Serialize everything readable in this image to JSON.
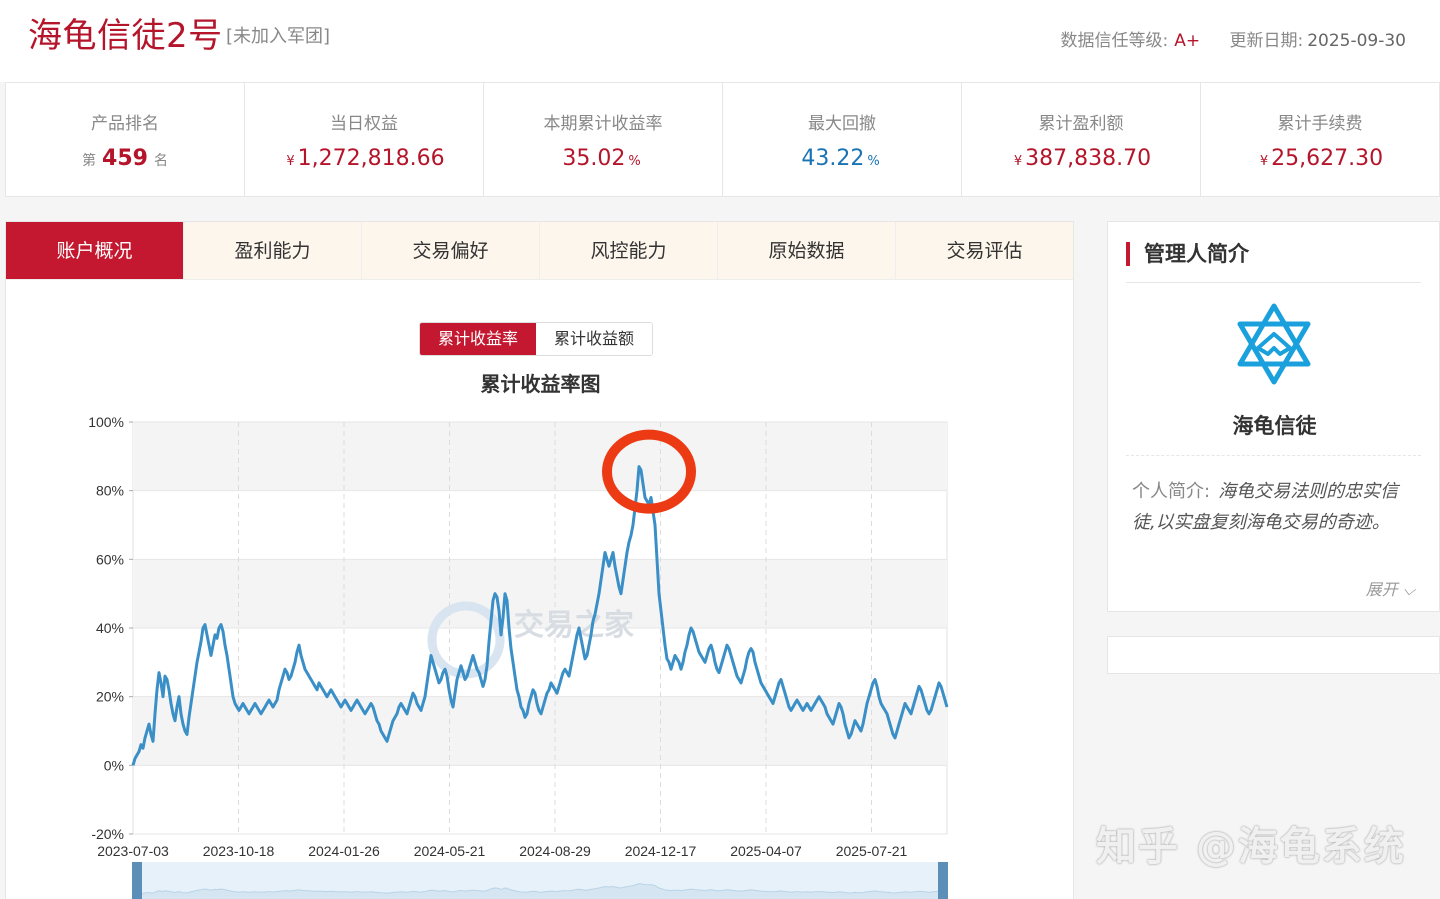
{
  "header": {
    "title": "海龟信徒2号",
    "tag": "[未加入军团]",
    "grade_label": "数据信任等级:",
    "grade": "A+",
    "date_label": "更新日期:",
    "date": "2025-09-30"
  },
  "stats": [
    {
      "label": "产品排名",
      "prefix": "第",
      "value": "459",
      "suffix": "名"
    },
    {
      "label": "当日权益",
      "prefix": "¥",
      "value": "1,272,818.66",
      "suffix": ""
    },
    {
      "label": "本期累计收益率",
      "prefix": "",
      "value": "35.02",
      "suffix": "%"
    },
    {
      "label": "最大回撤",
      "prefix": "",
      "value": "43.22",
      "suffix": "%"
    },
    {
      "label": "累计盈利额",
      "prefix": "¥",
      "value": "387,838.70",
      "suffix": ""
    },
    {
      "label": "累计手续费",
      "prefix": "¥",
      "value": "25,627.30",
      "suffix": ""
    }
  ],
  "tabs": [
    "账户概况",
    "盈利能力",
    "交易偏好",
    "风控能力",
    "原始数据",
    "交易评估"
  ],
  "chart_toggle": [
    "累计收益率",
    "累计收益额"
  ],
  "colors": {
    "brand": "#c3182f",
    "line": "#3a8fc7",
    "highlight": "#ec3b14"
  },
  "chart_data": {
    "type": "line",
    "title": "累计收益率图",
    "xlabel": "",
    "ylabel": "",
    "ylim": [
      -20,
      100
    ],
    "yticks": [
      "100%",
      "80%",
      "60%",
      "40%",
      "20%",
      "0%",
      "-20%"
    ],
    "xticks": [
      "2023-07-03",
      "2023-10-18",
      "2024-01-26",
      "2024-05-21",
      "2024-08-29",
      "2024-12-17",
      "2025-04-07",
      "2025-07-21"
    ],
    "grid": "vertical dashed, alternating horizontal bands",
    "x": [
      0,
      2,
      4,
      6,
      8,
      10,
      12,
      14,
      16,
      18,
      20,
      22,
      24,
      26,
      28,
      30,
      32,
      34,
      36,
      38,
      40,
      42,
      44,
      46,
      48,
      50,
      52,
      54,
      56,
      58,
      60,
      62,
      64,
      66,
      68,
      70,
      72,
      74,
      76,
      78,
      80,
      82,
      84,
      86,
      88,
      90,
      92,
      94,
      96,
      98,
      100,
      102,
      104,
      106,
      108,
      110,
      112,
      114,
      116,
      118,
      120,
      122,
      124,
      126,
      128,
      130,
      132,
      134,
      136,
      138,
      140,
      142,
      144,
      146,
      148,
      150,
      152,
      154,
      156,
      158,
      160,
      162,
      164,
      166,
      168,
      170,
      172,
      174,
      176,
      178,
      180,
      182,
      184,
      186,
      188,
      190,
      192,
      194,
      196,
      198,
      200,
      202,
      204,
      206,
      208,
      210,
      212,
      214,
      216,
      218,
      220,
      222,
      224,
      226,
      228,
      230,
      232,
      234,
      236,
      238,
      240,
      242,
      244,
      246,
      248,
      250,
      252,
      254,
      256,
      258,
      260,
      262,
      264,
      266,
      268,
      270,
      272,
      274,
      276,
      278,
      280,
      282,
      284,
      286,
      288,
      290,
      292,
      294,
      296,
      298,
      300,
      302,
      304,
      306,
      308,
      310,
      312,
      314,
      316,
      318,
      320,
      322,
      324,
      326,
      328,
      330,
      332,
      334,
      336,
      338,
      340,
      342,
      344,
      346,
      348,
      350,
      352,
      354,
      356,
      358,
      360,
      362,
      364,
      366,
      368,
      370,
      372,
      374,
      376,
      378,
      380,
      382,
      384,
      386,
      388,
      390,
      392,
      394,
      396,
      398,
      400,
      402,
      404,
      406,
      408,
      410,
      412,
      414,
      416,
      418,
      420,
      422,
      424,
      426,
      428,
      430,
      432,
      434,
      436,
      438,
      440,
      442,
      444,
      446,
      448,
      450,
      452,
      454,
      456,
      458,
      460,
      462,
      464,
      466,
      468,
      470,
      472,
      474,
      476,
      478,
      480,
      482,
      484,
      486,
      488,
      490,
      492,
      494,
      496,
      498,
      500,
      502,
      504,
      506,
      508,
      510,
      512,
      514,
      516,
      518,
      520,
      522,
      524,
      526,
      528,
      530,
      532,
      534,
      536,
      538,
      540,
      542,
      544,
      546,
      548,
      550,
      552,
      554,
      556,
      558,
      560,
      562,
      564,
      566,
      568,
      570,
      572,
      574,
      576,
      578,
      580,
      582,
      584,
      586,
      588,
      590,
      592,
      594,
      596,
      598,
      600,
      602,
      604,
      606,
      608,
      610,
      612,
      614,
      616,
      618,
      620,
      622,
      624,
      626,
      628,
      630,
      632,
      634,
      636,
      638,
      640,
      642,
      644,
      646,
      648,
      650,
      652,
      654,
      656,
      658,
      660,
      662,
      664,
      666,
      668,
      670,
      672,
      674,
      676,
      678,
      680,
      682,
      684,
      686,
      688,
      690,
      692,
      694,
      696,
      698,
      700,
      702,
      704,
      706,
      708,
      710,
      712,
      714,
      716,
      718,
      720,
      722,
      724,
      726,
      728,
      730,
      732,
      734,
      736,
      738,
      740,
      742,
      744,
      746,
      748,
      750,
      752,
      754,
      756,
      758,
      760,
      762,
      764,
      766,
      768,
      770,
      772,
      774,
      776,
      778,
      780,
      782,
      784,
      786,
      788,
      790,
      792,
      794,
      796,
      798,
      800,
      802,
      804,
      806,
      808,
      810,
      812,
      814
    ],
    "series": [
      {
        "values": [
          0,
          2,
          3,
          4,
          6,
          5,
          8,
          10,
          12,
          9,
          7,
          15,
          22,
          27,
          24,
          20,
          26,
          25,
          22,
          18,
          15,
          13,
          17,
          20,
          15,
          12,
          10,
          9,
          14,
          18,
          22,
          26,
          30,
          33,
          36,
          40,
          41,
          38,
          35,
          32,
          35,
          38,
          37,
          40,
          41,
          39,
          35,
          32,
          28,
          24,
          20,
          18,
          17,
          16,
          17,
          18,
          17,
          16,
          15,
          16,
          17,
          18,
          17,
          16,
          15,
          16,
          17,
          18,
          19,
          18,
          17,
          18,
          19,
          22,
          24,
          26,
          28,
          27,
          25,
          26,
          28,
          30,
          33,
          35,
          32,
          30,
          28,
          27,
          26,
          25,
          24,
          23,
          22,
          24,
          23,
          22,
          21,
          20,
          21,
          22,
          21,
          20,
          19,
          18,
          17,
          18,
          19,
          18,
          17,
          16,
          17,
          18,
          19,
          18,
          17,
          16,
          15,
          16,
          17,
          18,
          17,
          15,
          13,
          12,
          10,
          9,
          8,
          7,
          9,
          11,
          13,
          14,
          15,
          17,
          18,
          17,
          16,
          15,
          17,
          19,
          21,
          20,
          18,
          17,
          16,
          18,
          20,
          24,
          28,
          32,
          30,
          28,
          26,
          24,
          25,
          27,
          28,
          26,
          22,
          19,
          17,
          21,
          25,
          27,
          29,
          27,
          25,
          26,
          28,
          30,
          32,
          30,
          28,
          27,
          25,
          23,
          25,
          29,
          36,
          42,
          48,
          50,
          49,
          45,
          38,
          43,
          50,
          48,
          40,
          34,
          30,
          26,
          22,
          20,
          17,
          16,
          14,
          15,
          18,
          20,
          22,
          21,
          18,
          16,
          15,
          17,
          19,
          21,
          22,
          24,
          23,
          22,
          21,
          23,
          25,
          27,
          28,
          27,
          26,
          29,
          32,
          35,
          38,
          40,
          37,
          34,
          31,
          32,
          35,
          38,
          42,
          44,
          47,
          50,
          54,
          58,
          62,
          60,
          58,
          60,
          62,
          58,
          55,
          52,
          50,
          54,
          58,
          62,
          65,
          67,
          70,
          75,
          80,
          87,
          86,
          82,
          78,
          77,
          76,
          78,
          74,
          70,
          60,
          50,
          45,
          40,
          35,
          31,
          30,
          28,
          30,
          32,
          31,
          30,
          28,
          30,
          33,
          35,
          38,
          40,
          39,
          37,
          35,
          33,
          32,
          31,
          30,
          32,
          34,
          35,
          33,
          30,
          28,
          27,
          29,
          31,
          33,
          35,
          34,
          32,
          30,
          28,
          26,
          25,
          24,
          26,
          28,
          31,
          33,
          34,
          33,
          30,
          28,
          26,
          24,
          23,
          22,
          21,
          20,
          19,
          18,
          20,
          22,
          24,
          25,
          23,
          21,
          19,
          17,
          16,
          17,
          18,
          19,
          18,
          17,
          16,
          17,
          18,
          17,
          16,
          17,
          18,
          19,
          20,
          19,
          18,
          17,
          15,
          14,
          13,
          12,
          14,
          16,
          18,
          17,
          15,
          12,
          10,
          8,
          9,
          11,
          13,
          12,
          11,
          10,
          12,
          15,
          18,
          20,
          22,
          24,
          25,
          23,
          20,
          18,
          17,
          16,
          15,
          13,
          11,
          9,
          8,
          10,
          12,
          14,
          16,
          18,
          17,
          16,
          15,
          17,
          19,
          21,
          23,
          22,
          20,
          18,
          16,
          15,
          16,
          18,
          20,
          22,
          24,
          23,
          21,
          19,
          17,
          15,
          13,
          12,
          11,
          10,
          9,
          8,
          7,
          6,
          7,
          8,
          9,
          10,
          12,
          15,
          18,
          22,
          26,
          31,
          33,
          34,
          30,
          25,
          20,
          18,
          16,
          15,
          17,
          20,
          22,
          24,
          25,
          23,
          21,
          19,
          20,
          22,
          24,
          26,
          28,
          27,
          25,
          24,
          26,
          28,
          27,
          24,
          22,
          20,
          21,
          22,
          24,
          25,
          27,
          28,
          26,
          25,
          27,
          30,
          32,
          34,
          35
        ]
      }
    ]
  },
  "watermark_text": "交易之家",
  "manager": {
    "heading": "管理人简介",
    "name": "海龟信徒",
    "intro_label": "个人简介:",
    "intro": "海龟交易法则的忠实信徒,以实盘复刻海龟交易的奇迹。",
    "expand": "展开"
  },
  "page_watermark": "知乎 @海龟系统"
}
